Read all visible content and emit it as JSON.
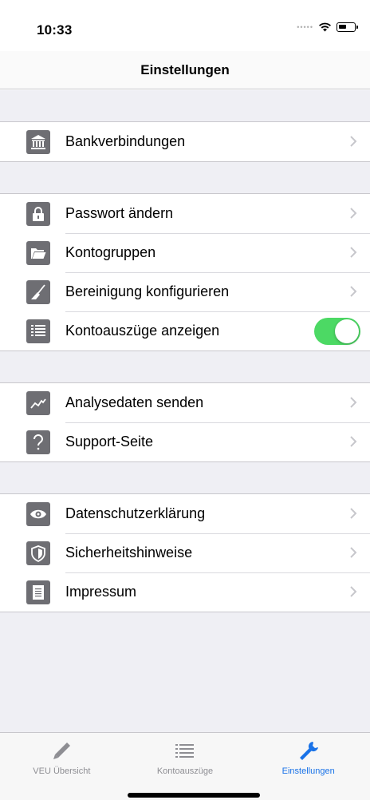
{
  "status_bar": {
    "time": "10:33"
  },
  "nav": {
    "title": "Einstellungen"
  },
  "sections": [
    {
      "rows": [
        {
          "label": "Bankverbindungen",
          "icon": "bank-icon",
          "accessory": "chevron"
        }
      ]
    },
    {
      "rows": [
        {
          "label": "Passwort ändern",
          "icon": "lock-icon",
          "accessory": "chevron"
        },
        {
          "label": "Kontogruppen",
          "icon": "folder-icon",
          "accessory": "chevron"
        },
        {
          "label": "Bereinigung konfigurieren",
          "icon": "broom-icon",
          "accessory": "chevron"
        },
        {
          "label": "Kontoauszüge anzeigen",
          "icon": "list-icon",
          "accessory": "toggle",
          "toggle_on": true
        }
      ]
    },
    {
      "rows": [
        {
          "label": "Analysedaten senden",
          "icon": "chart-icon",
          "accessory": "chevron"
        },
        {
          "label": "Support-Seite",
          "icon": "question-icon",
          "accessory": "chevron"
        }
      ]
    },
    {
      "rows": [
        {
          "label": "Datenschutzerklärung",
          "icon": "eye-icon",
          "accessory": "chevron"
        },
        {
          "label": "Sicherheitshinweise",
          "icon": "shield-icon",
          "accessory": "chevron"
        },
        {
          "label": "Impressum",
          "icon": "document-icon",
          "accessory": "chevron"
        }
      ]
    }
  ],
  "tabs": [
    {
      "label": "VEU Übersicht",
      "icon": "pencil-icon",
      "active": false
    },
    {
      "label": "Kontoauszüge",
      "icon": "list-icon",
      "active": false
    },
    {
      "label": "Einstellungen",
      "icon": "wrench-icon",
      "active": true
    }
  ],
  "colors": {
    "accent": "#1a73e8",
    "toggle_on": "#4cd964",
    "icon_bg": "#6e6e73",
    "group_bg": "#efeff4"
  }
}
